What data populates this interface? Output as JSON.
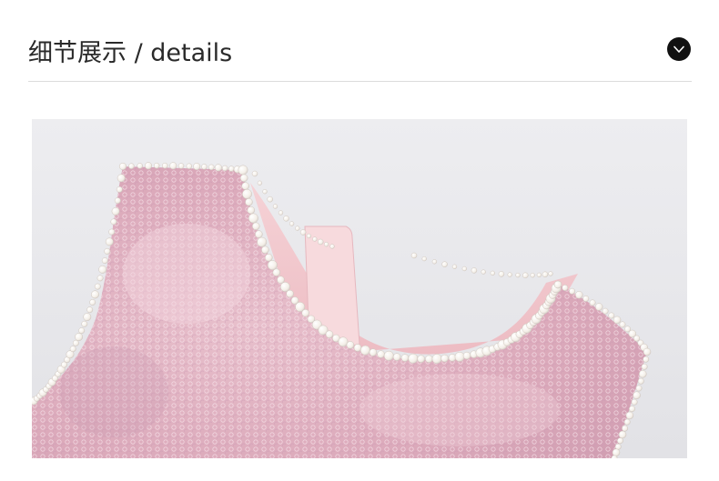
{
  "section": {
    "title": "细节展示 / details",
    "toggle_icon": "chevron-down-icon"
  },
  "colors": {
    "background": "#ffffff",
    "title_text": "#2a2a2a",
    "toggle_bg": "#111111",
    "divider": "#dcdcdc",
    "photo_backdrop": "#e7e7ea",
    "fabric": "#e2b3c2",
    "lining": "#f2c9cf",
    "pearl": "#fbf7f1"
  },
  "photo": {
    "subject_icon": "pink-sequin-dress-detail-photo"
  }
}
